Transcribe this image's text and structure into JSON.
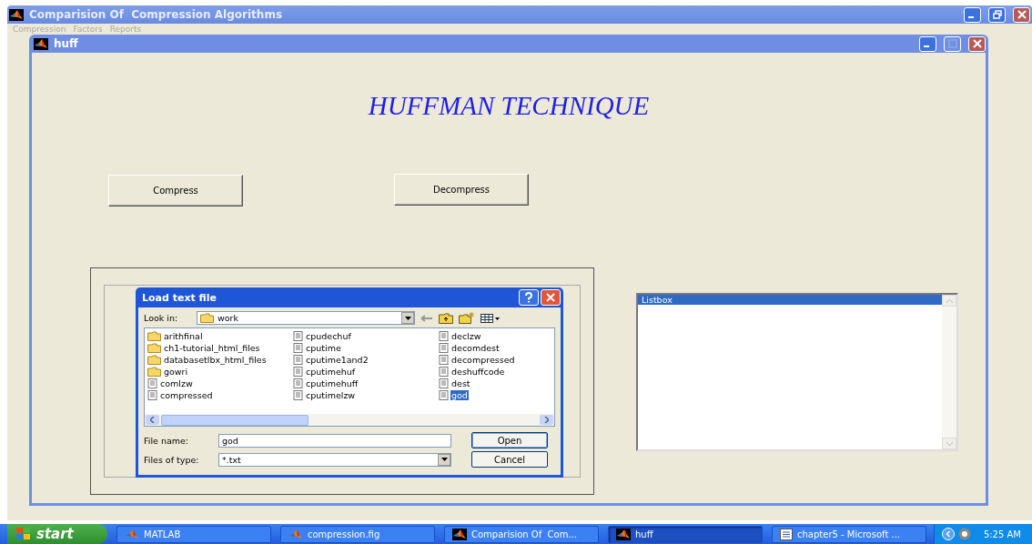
{
  "window": {
    "title": "Comparision Of  Compression Algorithms"
  },
  "menu": [
    "Compression",
    "Factors",
    "Reports"
  ],
  "huff_window": {
    "title": "huff",
    "heading": "HUFFMAN TECHNIQUE",
    "buttons": [
      "Compress",
      "Decompress"
    ]
  },
  "dialog": {
    "title": "Load text file",
    "look_in_label": "Look in:",
    "look_in": "work",
    "files": [
      {
        "name": "arithfinal",
        "kind": "folder",
        "selected": false
      },
      {
        "name": "ch1-tutorial_html_files",
        "kind": "folder",
        "selected": false
      },
      {
        "name": "databasetlbx_html_files",
        "kind": "folder",
        "selected": false
      },
      {
        "name": "gowri",
        "kind": "folder",
        "selected": false
      },
      {
        "name": "comlzw",
        "kind": "file",
        "selected": false
      },
      {
        "name": "compressed",
        "kind": "file",
        "selected": false
      },
      {
        "name": "cpudechuf",
        "kind": "file",
        "selected": false
      },
      {
        "name": "cputime",
        "kind": "file",
        "selected": false
      },
      {
        "name": "cputime1and2",
        "kind": "file",
        "selected": false
      },
      {
        "name": "cputimehuf",
        "kind": "file",
        "selected": false
      },
      {
        "name": "cputimehuff",
        "kind": "file",
        "selected": false
      },
      {
        "name": "cputimelzw",
        "kind": "file",
        "selected": false
      },
      {
        "name": "declzw",
        "kind": "file",
        "selected": false
      },
      {
        "name": "decomdest",
        "kind": "file",
        "selected": false
      },
      {
        "name": "decompressed",
        "kind": "file",
        "selected": false
      },
      {
        "name": "deshuffcode",
        "kind": "file",
        "selected": false
      },
      {
        "name": "dest",
        "kind": "file",
        "selected": false
      },
      {
        "name": "god",
        "kind": "file",
        "selected": true
      }
    ],
    "file_name_label": "File name:",
    "file_name": "god",
    "file_type_label": "Files of type:",
    "file_type": "*.txt",
    "buttons": [
      "Open",
      "Cancel"
    ]
  },
  "listbox": {
    "items": [
      {
        "label": "Listbox",
        "selected": true
      }
    ]
  },
  "taskbar": {
    "start": "start",
    "tasks": [
      {
        "label": "MATLAB",
        "kind": "matlab",
        "selected": false
      },
      {
        "label": "compression.fig",
        "kind": "matlab",
        "selected": false
      },
      {
        "label": "Comparision Of  Com...",
        "kind": "figure",
        "selected": false
      },
      {
        "label": "huff",
        "kind": "figure",
        "selected": true
      },
      {
        "label": "chapter5 - Microsoft ...",
        "kind": "word",
        "selected": false
      }
    ],
    "clock": "5:25 AM"
  }
}
